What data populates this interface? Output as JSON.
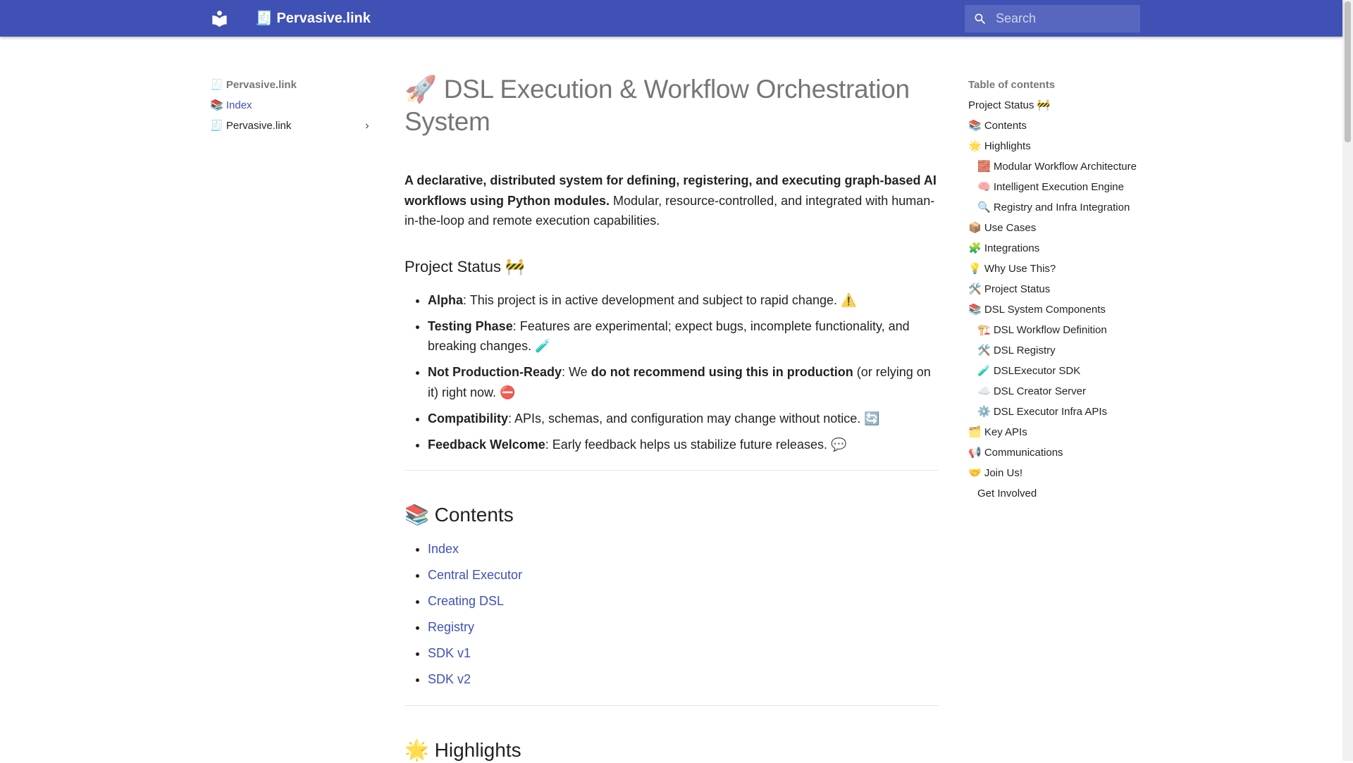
{
  "header": {
    "site_title": "🧾 Pervasive.link",
    "search_placeholder": "Search"
  },
  "nav": {
    "title": "🧾 Pervasive.link",
    "items": [
      {
        "label": "📚 Index"
      },
      {
        "label": "🧾 Pervasive.link"
      }
    ]
  },
  "page": {
    "title": "🚀 DSL Execution & Workflow Orchestration System",
    "lead_bold": "A declarative, distributed system for defining, registering, and executing graph-based AI workflows using Python modules.",
    "lead_rest": " Modular, resource-controlled, and integrated with human-in-the-loop and remote execution capabilities.",
    "status_heading": "Project Status 🚧",
    "status_items": [
      {
        "b1": "Alpha",
        "t1": ": This project is in active development and subject to rapid change. ⚠️",
        "b2": "",
        "t2": ""
      },
      {
        "b1": "Testing Phase",
        "t1": ": Features are experimental; expect bugs, incomplete functionality, and breaking changes. 🧪",
        "b2": "",
        "t2": ""
      },
      {
        "b1": "Not Production-Ready",
        "t1": ": We ",
        "b2": "do not recommend using this in production",
        "t2": " (or relying on it) right now. ⛔"
      },
      {
        "b1": "Compatibility",
        "t1": ": APIs, schemas, and configuration may change without notice. 🔄",
        "b2": "",
        "t2": ""
      },
      {
        "b1": "Feedback Welcome",
        "t1": ": Early feedback helps us stabilize future releases. 💬",
        "b2": "",
        "t2": ""
      }
    ],
    "contents_heading": "📚 Contents",
    "contents_links": [
      "Index",
      "Central Executor",
      "Creating DSL",
      "Registry",
      "SDK v1",
      "SDK v2"
    ],
    "highlights_heading": "🌟 Highlights"
  },
  "toc": {
    "title": "Table of contents",
    "items": [
      {
        "label": "Project Status 🚧",
        "level": 1
      },
      {
        "label": "📚 Contents",
        "level": 1
      },
      {
        "label": "🌟 Highlights",
        "level": 1
      },
      {
        "label": "🧱 Modular Workflow Architecture",
        "level": 2
      },
      {
        "label": "🧠 Intelligent Execution Engine",
        "level": 2
      },
      {
        "label": "🔍 Registry and Infra Integration",
        "level": 2
      },
      {
        "label": "📦 Use Cases",
        "level": 1
      },
      {
        "label": "🧩 Integrations",
        "level": 1
      },
      {
        "label": "💡 Why Use This?",
        "level": 1
      },
      {
        "label": "🛠️ Project Status",
        "level": 1
      },
      {
        "label": "📚 DSL System Components",
        "level": 1
      },
      {
        "label": "🏗️ DSL Workflow Definition",
        "level": 2
      },
      {
        "label": "🛠️ DSL Registry",
        "level": 2
      },
      {
        "label": "🧪 DSLExecutor SDK",
        "level": 2
      },
      {
        "label": "☁️ DSL Creator Server",
        "level": 2
      },
      {
        "label": "⚙️ DSL Executor Infra APIs",
        "level": 2
      },
      {
        "label": "🗂️ Key APIs",
        "level": 1
      },
      {
        "label": "📢 Communications",
        "level": 1
      },
      {
        "label": "🤝 Join Us!",
        "level": 1
      },
      {
        "label": "Get Involved",
        "level": 2
      }
    ]
  }
}
